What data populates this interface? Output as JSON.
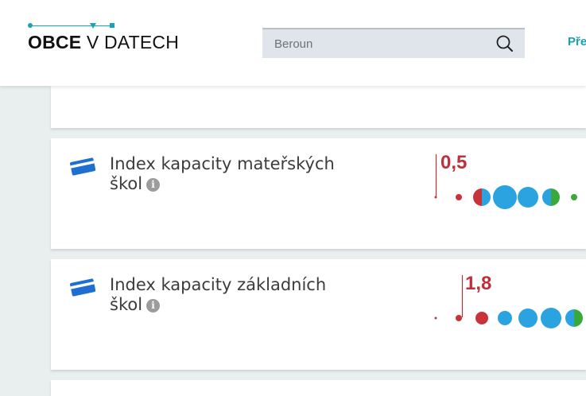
{
  "header": {
    "logo": {
      "bold": "OBCE",
      "rest": "V DATECH"
    },
    "search": {
      "value": "",
      "placeholder": "Beroun",
      "icon": "search-icon"
    },
    "nav_link": "Pře"
  },
  "colors": {
    "accent": "#1aa3b8",
    "highlight_red": "#c0303a",
    "blue": "#2aa3e0",
    "green": "#3aa83a",
    "card_icon_blue": "#1e6fd0"
  },
  "indicators": [
    {
      "title": "Index kapacity mateřských škol",
      "icon": "card-icon",
      "info_icon": "info-icon",
      "value_label": "0,5",
      "dots": [
        {
          "fill": "red"
        },
        {
          "fill": "red"
        },
        {
          "fill": "red-blue"
        },
        {
          "fill": "blue"
        },
        {
          "fill": "blue"
        },
        {
          "fill": "blue-green"
        },
        {
          "fill": "green"
        }
      ]
    },
    {
      "title": "Index kapacity základních škol",
      "icon": "card-icon",
      "info_icon": "info-icon",
      "value_label": "1,8",
      "dots": [
        {
          "fill": "red"
        },
        {
          "fill": "red"
        },
        {
          "fill": "red"
        },
        {
          "fill": "blue"
        },
        {
          "fill": "blue"
        },
        {
          "fill": "blue"
        },
        {
          "fill": "blue-green"
        }
      ]
    }
  ]
}
